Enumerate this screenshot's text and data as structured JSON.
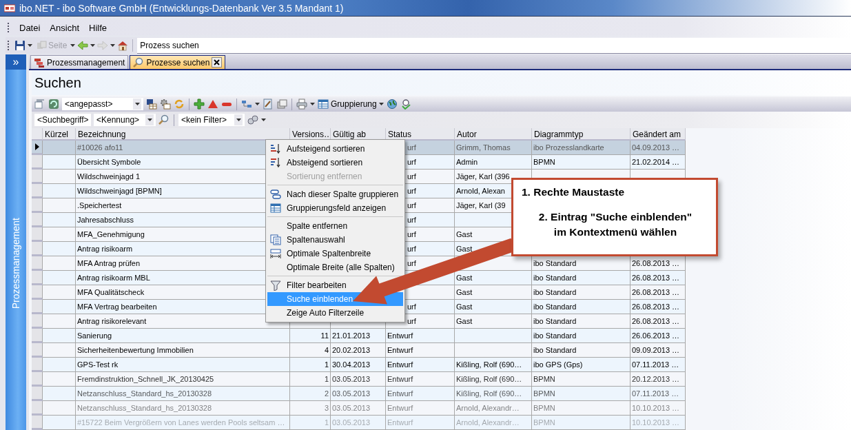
{
  "window": {
    "title": "ibo.NET - ibo Software GmbH (Entwicklungs-Datenbank Ver 3.5 Mandant 1)"
  },
  "menu": [
    "Datei",
    "Ansicht",
    "Hilfe"
  ],
  "nav_toolbar": {
    "page_button": "Seite",
    "address": "Prozess suchen"
  },
  "sidebar": {
    "expand_button": "»",
    "title": "Prozessmanagement"
  },
  "tabs": [
    {
      "label": "Prozessmanagement",
      "selected": false
    },
    {
      "label": "Prozesse suchen",
      "selected": true
    }
  ],
  "panel_title": "Suchen",
  "toolbar": {
    "view_combo": "<angepasst>",
    "group_button": "Gruppierung"
  },
  "filter_bar": {
    "search_field": "<Suchbegriff>",
    "id_combo": "<Kennung>",
    "filter_combo": "<kein Filter>"
  },
  "table": {
    "columns": [
      "Kürzel",
      "Bezeichnung",
      "Versions…",
      "Gültig ab",
      "Status",
      "Autor",
      "Diagrammtyp",
      "Geändert am"
    ],
    "rows": [
      {
        "selected": true,
        "cells": [
          null,
          "#10026 afo11",
          null,
          null,
          "urf",
          "Grimm, Thomas",
          "ibo Prozesslandkarte",
          "04.09.2013 …"
        ]
      },
      {
        "selected": false,
        "cells": [
          null,
          "Übersicht Symbole",
          null,
          null,
          "urf",
          "Admin",
          "BPMN",
          "21.02.2014 …"
        ]
      },
      {
        "selected": false,
        "cells": [
          null,
          "Wildschweinjagd  1",
          null,
          null,
          "urf",
          "Jäger, Karl (396",
          null,
          null
        ]
      },
      {
        "selected": false,
        "cells": [
          null,
          "Wildschweinjagd  [BPMN]",
          null,
          null,
          "urf",
          "Arnold, Alexan",
          null,
          null
        ]
      },
      {
        "selected": false,
        "cells": [
          null,
          ".Speichertest",
          null,
          null,
          "urf",
          "Jäger, Karl (39",
          null,
          null
        ]
      },
      {
        "selected": false,
        "cells": [
          null,
          "Jahresabschluss",
          null,
          null,
          "urf",
          null,
          null,
          null
        ]
      },
      {
        "selected": false,
        "cells": [
          null,
          "MFA_Genehmigung",
          null,
          null,
          "urf",
          "Gast",
          null,
          null
        ]
      },
      {
        "selected": false,
        "cells": [
          null,
          "Antrag risikoarm",
          null,
          null,
          "urf",
          "Gast",
          null,
          null
        ]
      },
      {
        "selected": false,
        "cells": [
          null,
          "MFA Antrag prüfen",
          null,
          null,
          "urf",
          null,
          "ibo Standard",
          "26.08.2013 …"
        ]
      },
      {
        "selected": false,
        "cells": [
          null,
          "Antrag risikoarm MBL",
          null,
          null,
          null,
          "Gast",
          "ibo Standard",
          "26.08.2013 …"
        ]
      },
      {
        "selected": false,
        "cells": [
          null,
          "MFA Qualitätscheck",
          null,
          null,
          null,
          "Gast",
          "ibo Standard",
          "26.08.2013 …"
        ]
      },
      {
        "selected": false,
        "cells": [
          null,
          "MFA Vertrag bearbeiten",
          null,
          null,
          "urf",
          "Gast",
          "ibo Standard",
          "26.08.2013 …"
        ]
      },
      {
        "selected": false,
        "cells": [
          null,
          "Antrag risikorelevant",
          null,
          null,
          "urf",
          "Gast",
          "ibo Standard",
          "26.08.2013 …"
        ]
      },
      {
        "selected": false,
        "cells": [
          null,
          "Sanierung",
          "11",
          "21.01.2013",
          "Entwurf",
          null,
          "ibo Standard",
          "26.06.2013 …"
        ]
      },
      {
        "selected": false,
        "cells": [
          null,
          "Sicherheitenbewertung Immobilien",
          "4",
          "20.02.2013",
          "Entwurf",
          null,
          "ibo Standard",
          "09.09.2013 …"
        ]
      },
      {
        "selected": false,
        "cells": [
          null,
          "GPS-Test rk",
          "1",
          "30.04.2013",
          "Entwurf",
          "Kißling, Rolf (690…",
          "ibo GPS (Gps)",
          "07.11.2013 …"
        ]
      },
      {
        "selected": false,
        "cells": [
          null,
          "Fremdinstruktion_Schnell_JK_20130425",
          "1",
          "03.05.2013",
          "Entwurf",
          "Kißling, Rolf (690…",
          "BPMN",
          "20.12.2013 …"
        ]
      },
      {
        "selected": false,
        "cells": [
          null,
          "Netzanschluss_Standard_hs_20130328",
          "2",
          "03.05.2013",
          "Entwurf",
          "Kißling, Rolf (690…",
          "BPMN",
          "07.11.2013 …"
        ]
      },
      {
        "selected": false,
        "cells": [
          null,
          "Netzanschluss_Standard_hs_20130328",
          "3",
          "03.05.2013",
          "Entwurf",
          "Arnold, Alexandr…",
          "BPMN",
          "10.10.2013 …"
        ]
      },
      {
        "selected": false,
        "cells": [
          null,
          "#15722 Beim Vergrößern von Lanes werden Pools seltsam …",
          "1",
          "03.05.2013",
          "Entwurf",
          "Arnold, Alexandr…",
          "BPMN",
          "10.10.2013 …"
        ]
      }
    ]
  },
  "context_menu": {
    "items": [
      {
        "kind": "item",
        "label": "Aufsteigend sortieren",
        "disabled": false,
        "selected": false
      },
      {
        "kind": "item",
        "label": "Absteigend sortieren",
        "disabled": false,
        "selected": false
      },
      {
        "kind": "item",
        "label": "Sortierung entfernen",
        "disabled": true,
        "selected": false
      },
      {
        "kind": "separator"
      },
      {
        "kind": "item",
        "label": "Nach dieser Spalte gruppieren",
        "disabled": false,
        "selected": false
      },
      {
        "kind": "item",
        "label": "Gruppierungsfeld anzeigen",
        "disabled": false,
        "selected": false
      },
      {
        "kind": "separator"
      },
      {
        "kind": "item",
        "label": "Spalte entfernen",
        "disabled": false,
        "selected": false
      },
      {
        "kind": "item",
        "label": "Spaltenauswahl",
        "disabled": false,
        "selected": false
      },
      {
        "kind": "item",
        "label": "Optimale Spaltenbreite",
        "disabled": false,
        "selected": false
      },
      {
        "kind": "item",
        "label": "Optimale Breite (alle Spalten)",
        "disabled": false,
        "selected": false
      },
      {
        "kind": "separator"
      },
      {
        "kind": "item",
        "label": "Filter bearbeiten",
        "disabled": false,
        "selected": false
      },
      {
        "kind": "item",
        "label": "Suche einblenden",
        "disabled": false,
        "selected": true
      },
      {
        "kind": "item",
        "label": "Zeige Auto Filterzeile",
        "disabled": false,
        "selected": false
      }
    ]
  },
  "callout": {
    "lines": [
      "1. Rechte Maustaste",
      "2. Eintrag \"Suche einblenden\"",
      "im Kontextmenü wählen"
    ]
  }
}
